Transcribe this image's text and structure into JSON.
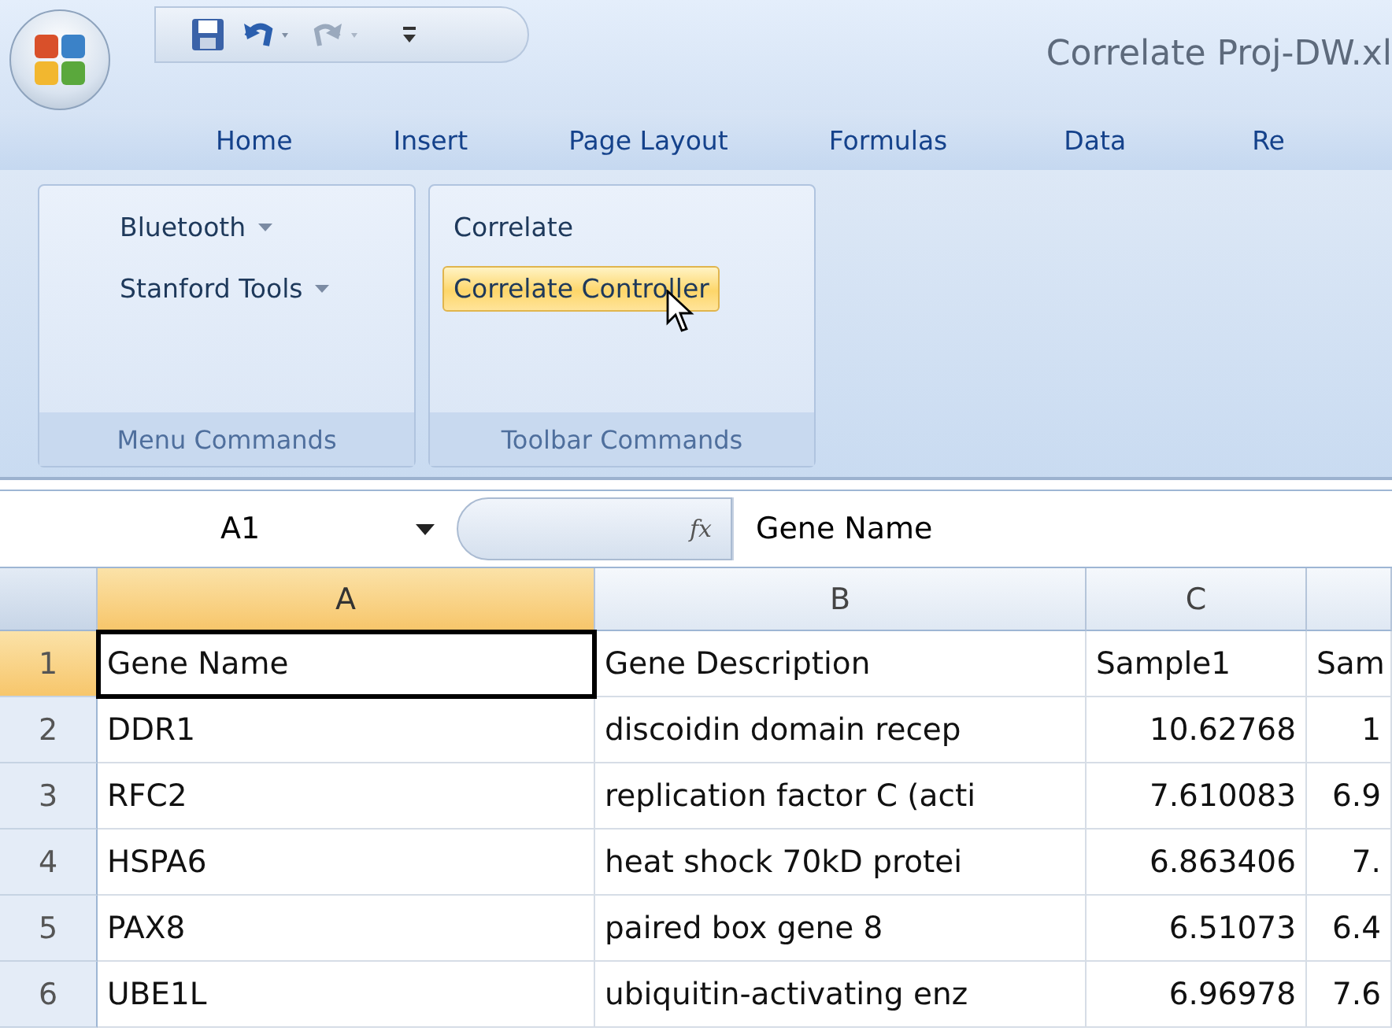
{
  "window": {
    "title": "Correlate Proj-DW.xl"
  },
  "quick_access": [
    {
      "kind": "save",
      "disabled": false
    },
    {
      "kind": "undo",
      "disabled": false
    },
    {
      "kind": "redo",
      "disabled": true
    },
    {
      "kind": "customize",
      "disabled": false
    }
  ],
  "tabs": [
    {
      "label": "Home",
      "selected": false
    },
    {
      "label": "Insert",
      "selected": false
    },
    {
      "label": "Page Layout",
      "selected": false
    },
    {
      "label": "Formulas",
      "selected": false
    },
    {
      "label": "Data",
      "selected": false
    },
    {
      "label": "Re",
      "selected": false
    }
  ],
  "ribbon_groups": [
    {
      "label": "Menu Commands",
      "items": [
        {
          "label": "Bluetooth",
          "kind": "dropdown",
          "hovered": false
        },
        {
          "label": "Stanford Tools",
          "kind": "dropdown",
          "hovered": false
        }
      ]
    },
    {
      "label": "Toolbar Commands",
      "items": [
        {
          "label": "Correlate",
          "kind": "button",
          "hovered": false
        },
        {
          "label": "Correlate Controller",
          "kind": "button",
          "hovered": true
        }
      ]
    }
  ],
  "formula_bar": {
    "name_box": "A1",
    "function_label": "fx",
    "formula": "Gene Name"
  },
  "sheet": {
    "columns": [
      {
        "label": "A",
        "selected": true
      },
      {
        "label": "B",
        "selected": false
      },
      {
        "label": "C",
        "selected": false
      },
      {
        "selected": false
      }
    ],
    "rows": [
      {
        "number": "1",
        "selected": true,
        "cells": [
          {
            "text": "Gene Name",
            "kind": "text",
            "selected": true
          },
          {
            "text": "Gene Description",
            "kind": "text",
            "selected": false
          },
          {
            "text": "Sample1",
            "kind": "text",
            "selected": false
          },
          {
            "text": "Sam",
            "kind": "text",
            "selected": false
          }
        ]
      },
      {
        "number": "2",
        "selected": false,
        "cells": [
          {
            "text": "DDR1",
            "kind": "text",
            "selected": false
          },
          {
            "text": "discoidin domain recep",
            "kind": "text",
            "selected": false
          },
          {
            "text": "10.62768",
            "kind": "number",
            "selected": false
          },
          {
            "text": "1",
            "kind": "number",
            "selected": false
          }
        ]
      },
      {
        "number": "3",
        "selected": false,
        "cells": [
          {
            "text": "RFC2",
            "kind": "text",
            "selected": false
          },
          {
            "text": "replication factor C (acti",
            "kind": "text",
            "selected": false
          },
          {
            "text": "7.610083",
            "kind": "number",
            "selected": false
          },
          {
            "text": "6.9",
            "kind": "number",
            "selected": false
          }
        ]
      },
      {
        "number": "4",
        "selected": false,
        "cells": [
          {
            "text": "HSPA6",
            "kind": "text",
            "selected": false
          },
          {
            "text": "heat shock 70kD protei",
            "kind": "text",
            "selected": false
          },
          {
            "text": "6.863406",
            "kind": "number",
            "selected": false
          },
          {
            "text": "7.",
            "kind": "number",
            "selected": false
          }
        ]
      },
      {
        "number": "5",
        "selected": false,
        "cells": [
          {
            "text": "PAX8",
            "kind": "text",
            "selected": false
          },
          {
            "text": "paired box gene 8",
            "kind": "text",
            "selected": false
          },
          {
            "text": "6.51073",
            "kind": "number",
            "selected": false
          },
          {
            "text": "6.4",
            "kind": "number",
            "selected": false
          }
        ]
      },
      {
        "number": "6",
        "selected": false,
        "cells": [
          {
            "text": "UBE1L",
            "kind": "text",
            "selected": false
          },
          {
            "text": "ubiquitin-activating enz",
            "kind": "text",
            "selected": false
          },
          {
            "text": "6.96978",
            "kind": "number",
            "selected": false
          },
          {
            "text": "7.6",
            "kind": "number",
            "selected": false
          }
        ]
      }
    ]
  }
}
